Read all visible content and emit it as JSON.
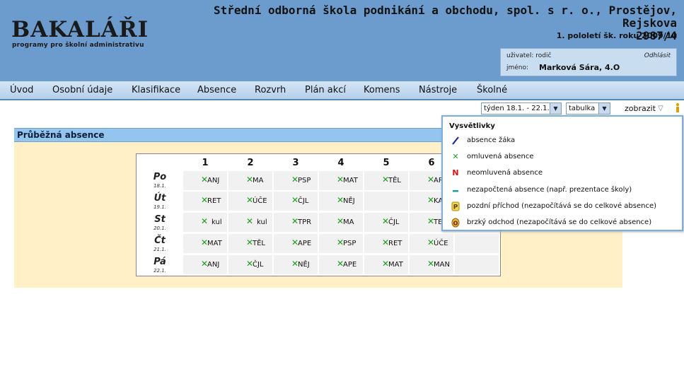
{
  "header": {
    "logo_main": "BAKALÁŘI",
    "logo_sub": "programy pro školní administrativu",
    "school_line1": "Střední odborná škola podnikání a obchodu, spol. s r. o., Prostějov, Rejskova",
    "school_line2": "2987/4",
    "term": "1. pololetí šk. roku 2009/10",
    "user_label": "uživatel: rodič",
    "logout": "Odhlásit",
    "name_label": "jméno:",
    "name_value": "Marková Sára, 4.O"
  },
  "nav": [
    "Úvod",
    "Osobní údaje",
    "Klasifikace",
    "Absence",
    "Rozvrh",
    "Plán akcí",
    "Komens",
    "Nástroje",
    "Školné"
  ],
  "controls": {
    "week_select": "týden 18.1. - 22.1.",
    "view_select": "tabulka",
    "show_label": "zobrazit"
  },
  "panel": {
    "title": "Průběžná absence",
    "columns": [
      "1",
      "2",
      "3",
      "4",
      "5",
      "6"
    ],
    "rows": [
      {
        "day": "Po",
        "date": "18.1.",
        "cells": [
          "ANJ",
          "MA",
          "PSP",
          "MAT",
          "TĚL",
          "AR"
        ]
      },
      {
        "day": "Út",
        "date": "19.1.",
        "cells": [
          "RET",
          "ÚČE",
          "ČJL",
          "NĚJ",
          "",
          "KA"
        ]
      },
      {
        "day": "St",
        "date": "20.1.",
        "cells": [
          "kul",
          "kul",
          "TPR",
          "MA",
          "ČJL",
          "TE"
        ]
      },
      {
        "day": "Čt",
        "date": "21.1.",
        "cells": [
          "MAT",
          "TĚL",
          "APE",
          "PSP",
          "RET",
          "ÚČE"
        ]
      },
      {
        "day": "Pá",
        "date": "22.1.",
        "cells": [
          "ANJ",
          "ČJL",
          "NĚJ",
          "APE",
          "MAT",
          "MAN"
        ]
      }
    ]
  },
  "legend": {
    "title": "Vysvětlivky",
    "items": [
      {
        "icon": "slash-icon",
        "text": "absence žáka"
      },
      {
        "icon": "green-x-icon",
        "text": "omluvená absence"
      },
      {
        "icon": "red-n-icon",
        "text": "neomluvená absence"
      },
      {
        "icon": "dash-icon",
        "text": "nezapočtená absence (např. prezentace školy)"
      },
      {
        "icon": "late-arrival-icon",
        "text": "pozdní příchod (nezapočítává se do celkové absence)"
      },
      {
        "icon": "early-leave-icon",
        "text": "brzký odchod (nezapočítává se do celkové absence)"
      }
    ]
  },
  "colors": {
    "header": "#6b9ccd",
    "panel": "#fff0c8",
    "panel_title": "#93c5ef",
    "excused": "#1aa21a",
    "unexcused": "#e01010"
  }
}
